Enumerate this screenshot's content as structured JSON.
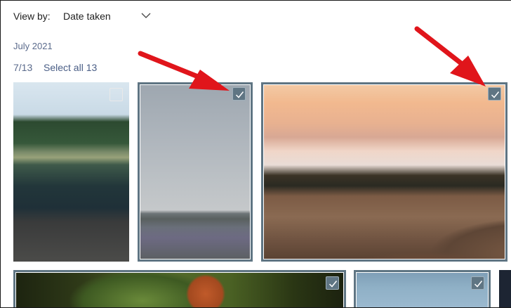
{
  "header": {
    "view_by_label": "View by:",
    "view_by_value": "Date taken"
  },
  "group": {
    "month": "July 2021",
    "selected_count": "7/13",
    "select_all_label": "Select all 13"
  },
  "tiles": [
    {
      "scene": "lake with person on rocks",
      "selected": false
    },
    {
      "scene": "misty grey sky over meadow",
      "selected": true
    },
    {
      "scene": "sunset over fog and hills",
      "selected": true
    },
    {
      "scene": "green forest foliage",
      "selected": true
    },
    {
      "scene": "blue sky",
      "selected": true
    },
    {
      "scene": "dark image",
      "selected": false
    }
  ],
  "colors": {
    "selection_outline": "#5f7583",
    "annotation_arrow": "#e0151b",
    "label_blue": "#5b6b8c"
  },
  "icons": [
    "chevron-down-icon",
    "checkbox-icon",
    "checkmark-icon"
  ]
}
